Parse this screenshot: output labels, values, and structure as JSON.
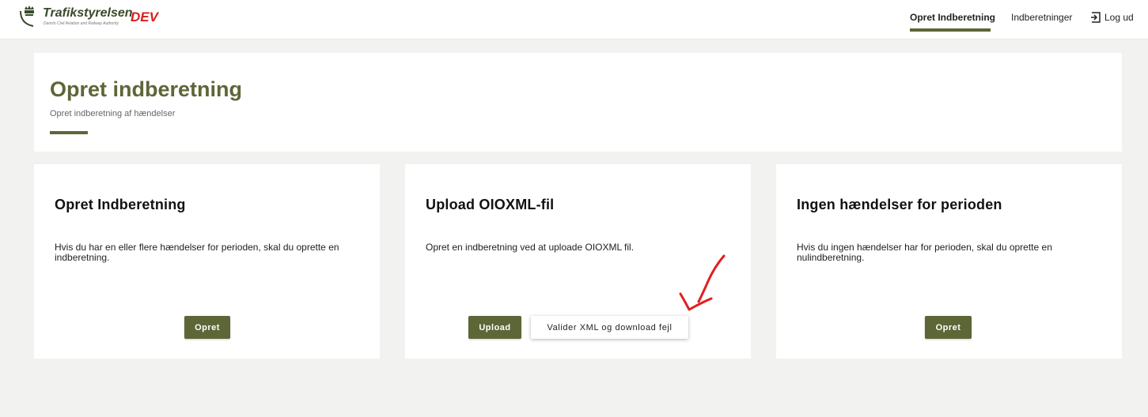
{
  "header": {
    "logo_name": "Trafikstyrelsen",
    "logo_sub": "Danish Civil Aviation and Railway Authority",
    "env_label": "DEV",
    "nav": {
      "create_label": "Opret Indberetning",
      "reports_label": "Indberetninger",
      "logout_label": "Log ud"
    }
  },
  "hero": {
    "title": "Opret indberetning",
    "subtitle": "Opret indberetning af hændelser"
  },
  "cards": [
    {
      "title": "Opret Indberetning",
      "text": "Hvis du har en eller flere hændelser for perioden, skal du oprette en indberetning.",
      "button_label": "Opret"
    },
    {
      "title": "Upload OIOXML-fil",
      "text": "Opret en indberetning ved at uploade OIOXML fil.",
      "button_label": "Upload",
      "secondary_button_label": "Valider XML og download fejl"
    },
    {
      "title": "Ingen hændelser for perioden",
      "text": "Hvis du ingen hændelser har for perioden, skal du oprette en nulindberetning.",
      "button_label": "Opret"
    }
  ],
  "colors": {
    "brand": "#5d6637",
    "env": "#d81e1e",
    "annotation": "#e02020",
    "background": "#f2f2f0"
  },
  "icons": {
    "logo": "crown-logo-icon",
    "logout": "logout-icon",
    "annotation": "red-arrow-annotation"
  }
}
